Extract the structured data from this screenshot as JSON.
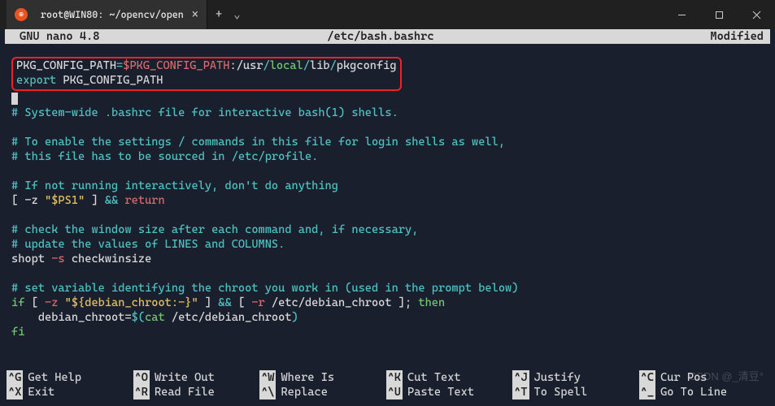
{
  "titlebar": {
    "tab_title": "root@WIN80: ~/opencv/open",
    "close_glyph": "×",
    "plus_glyph": "+",
    "chevron_glyph": "⌄"
  },
  "status": {
    "left": "GNU nano  4.8",
    "center": "/etc/bash.bashrc",
    "right": "Modified"
  },
  "code": {
    "line1": {
      "var": "PKG_CONFIG_PATH",
      "eq": "=",
      "val1": "$PKG_CONFIG_PATH",
      "colon1": ":",
      "seg1": "/usr",
      "slash1": "/",
      "seg2": "local",
      "slash2": "/",
      "seg3": "lib",
      "slash3": "/",
      "seg4": "pkgconfig"
    },
    "line2": {
      "kw": "export",
      "rest": " PKG_CONFIG_PATH"
    },
    "line4": "# System-wide .bashrc file for interactive bash(1) shells.",
    "line6": "# To enable the settings / commands in this file for login shells as well,",
    "line7": "# this file has to be sourced in /etc/profile.",
    "line9": "# If not running interactively, don't do anything",
    "line10": {
      "a": "[ -z ",
      "b": "\"$PS1\"",
      "c": " ] ",
      "d": "&&",
      "e": " ",
      "f": "return"
    },
    "line12": "# check the window size after each command and, if necessary,",
    "line13": "# update the values of LINES and COLUMNS.",
    "line14": {
      "a": "shopt ",
      "b": "-s",
      "c": " checkwinsize"
    },
    "line16": "# set variable identifying the chroot you work in (used in the prompt below)",
    "line17": {
      "a": "if",
      "b": " [ ",
      "c": "-z",
      "d": " ",
      "e": "\"${debian_chroot:-}\"",
      "f": " ] ",
      "g": "&&",
      "h": " [ ",
      "i": "-r",
      "j": " /etc/debian_chroot ]; ",
      "k": "then"
    },
    "line18": {
      "a": "    debian_chroot=",
      "b": "$(",
      "c": "cat",
      "d": " /etc/debian_chroot",
      "e": ")"
    },
    "line19": "fi"
  },
  "shortcuts": [
    {
      "key": "^G",
      "label": "Get Help"
    },
    {
      "key": "^O",
      "label": "Write Out"
    },
    {
      "key": "^W",
      "label": "Where Is"
    },
    {
      "key": "^K",
      "label": "Cut Text"
    },
    {
      "key": "^J",
      "label": "Justify"
    },
    {
      "key": "^C",
      "label": "Cur Pos"
    },
    {
      "key": "^X",
      "label": "Exit"
    },
    {
      "key": "^R",
      "label": "Read File"
    },
    {
      "key": "^\\",
      "label": "Replace"
    },
    {
      "key": "^U",
      "label": "Paste Text"
    },
    {
      "key": "^T",
      "label": "To Spell"
    },
    {
      "key": "^_",
      "label": "Go To Line"
    }
  ],
  "watermark": "CSDN @_清豆°"
}
